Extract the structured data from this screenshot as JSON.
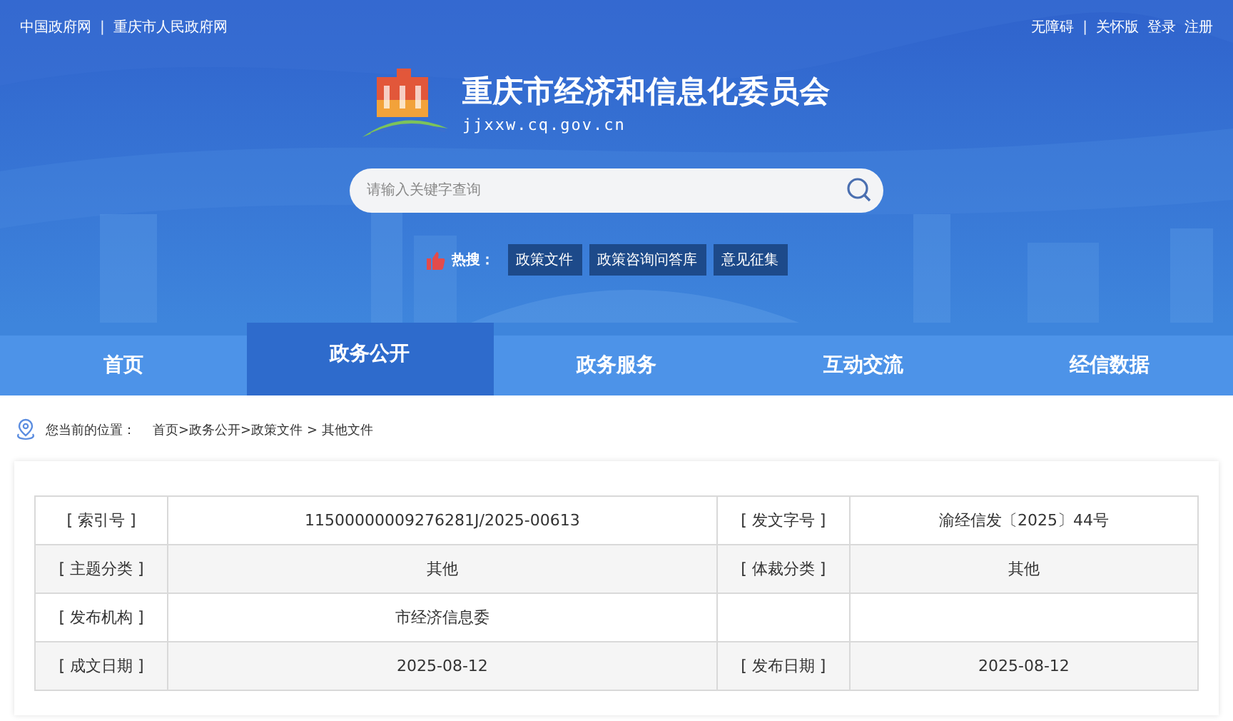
{
  "top_left": [
    {
      "kind": "link",
      "text": "中国政府网"
    },
    {
      "kind": "separator",
      "text": "|"
    },
    {
      "kind": "link",
      "text": "重庆市人民政府网"
    }
  ],
  "top_right": [
    {
      "kind": "link",
      "text": "无障碍"
    },
    {
      "kind": "separator",
      "text": "|"
    },
    {
      "kind": "link",
      "text": "关怀版"
    },
    {
      "kind": "link",
      "text": "登录"
    },
    {
      "kind": "link",
      "text": "注册"
    }
  ],
  "site": {
    "title": "重庆市经济和信息化委员会",
    "url": "jjxxw.cq.gov.cn"
  },
  "search": {
    "placeholder": "请输入关键字查询"
  },
  "hot_search": {
    "label": "热搜：",
    "tags": [
      "政策文件",
      "政策咨询问答库",
      "意见征集"
    ]
  },
  "nav": [
    {
      "label": "首页",
      "selected": false
    },
    {
      "label": "政务公开",
      "selected": true
    },
    {
      "label": "政务服务",
      "selected": false
    },
    {
      "label": "互动交流",
      "selected": false
    },
    {
      "label": "经信数据",
      "selected": false
    }
  ],
  "breadcrumb": {
    "label": "您当前的位置：",
    "path": "首页>政务公开>政策文件 > 其他文件"
  },
  "table": {
    "rows": [
      {
        "pairs": [
          {
            "label": "[ 索引号 ]",
            "value": "11500000009276281J/2025-00613"
          },
          {
            "label": "[ 发文字号 ]",
            "value": "渝经信发〔2025〕44号"
          }
        ]
      },
      {
        "pairs": [
          {
            "label": "[ 主题分类 ]",
            "value": "其他"
          },
          {
            "label": "[ 体裁分类 ]",
            "value": "其他"
          }
        ]
      },
      {
        "pairs": [
          {
            "label": "[ 发布机构 ]",
            "value": "市经济信息委"
          }
        ]
      },
      {
        "pairs": [
          {
            "label": "[ 成文日期 ]",
            "value": "2025-08-12"
          },
          {
            "label": "[ 发布日期 ]",
            "value": "2025-08-12"
          }
        ]
      }
    ]
  }
}
